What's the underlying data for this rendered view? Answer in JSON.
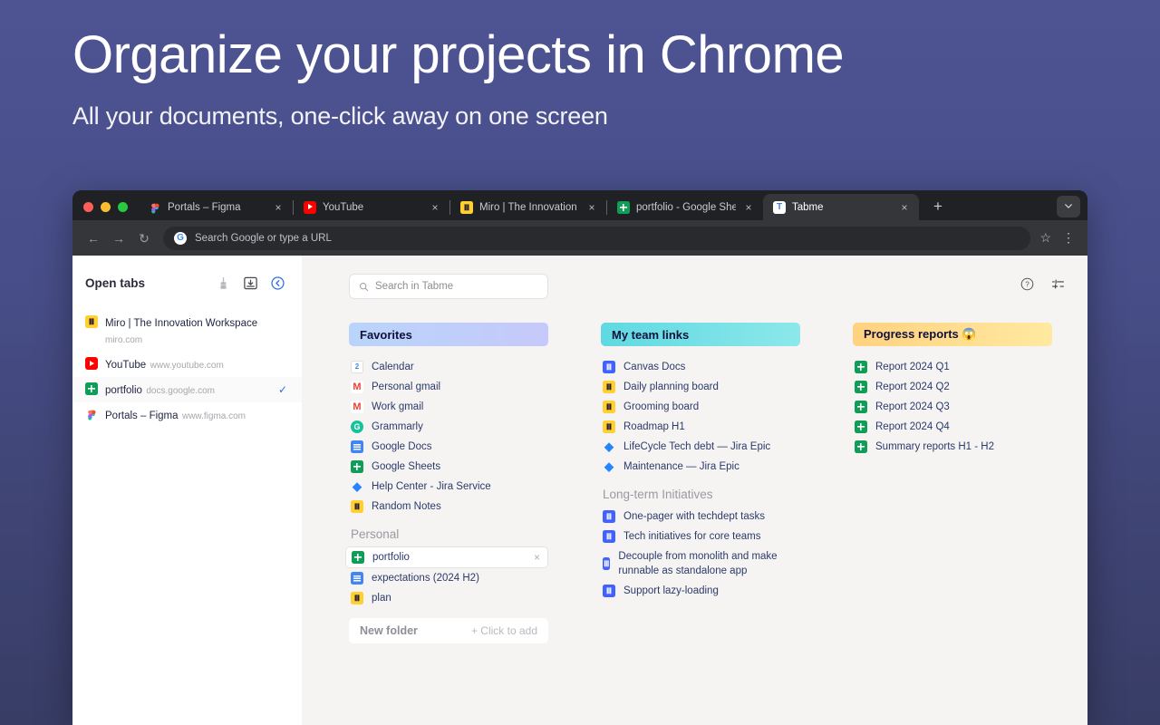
{
  "promo": {
    "title": "Organize your projects in Chrome",
    "subtitle": "All your documents, one-click away on one screen"
  },
  "browser": {
    "tabs": [
      {
        "title": "Portals – Figma",
        "favicon": "figma-icon",
        "close_label": "×",
        "active": false
      },
      {
        "title": "YouTube",
        "favicon": "youtube-icon",
        "close_label": "×",
        "active": false
      },
      {
        "title": "Miro | The Innovation Worksp",
        "favicon": "miro-icon",
        "close_label": "×",
        "active": false
      },
      {
        "title": "portfolio - Google Sheets",
        "favicon": "google-sheets-icon",
        "close_label": "×",
        "active": false
      },
      {
        "title": "Tabme",
        "favicon": "tabme-icon",
        "close_label": "×",
        "active": true
      }
    ],
    "new_tab_label": "+",
    "tab_list_chevron": "⌄",
    "nav": {
      "back": "←",
      "forward": "→",
      "reload": "↻"
    },
    "omnibox": {
      "placeholder": "Search Google or type a URL",
      "value": "",
      "engine_badge": "G"
    },
    "omnibox_actions": {
      "bookmark": "☆",
      "menu": "⋮"
    }
  },
  "sidebar": {
    "title": "Open tabs",
    "actions": [
      {
        "name": "clean-icon",
        "label": ""
      },
      {
        "name": "save-session-icon",
        "label": ""
      },
      {
        "name": "collapse-icon",
        "label": ""
      }
    ],
    "open_tabs": [
      {
        "title": "Miro | The Innovation Workspace",
        "url": "miro.com",
        "favicon": "miro-icon",
        "checked": false
      },
      {
        "title": "YouTube",
        "url": "www.youtube.com",
        "favicon": "youtube-icon",
        "checked": false
      },
      {
        "title": "portfolio",
        "url": "docs.google.com",
        "favicon": "google-sheets-icon",
        "checked": true,
        "check_glyph": "✓"
      },
      {
        "title": "Portals – Figma",
        "url": "www.figma.com",
        "favicon": "figma-icon",
        "checked": false
      }
    ]
  },
  "toolbar": {
    "search_placeholder": "Search in Tabme",
    "search_value": "",
    "search_icon": "🔍",
    "help_icon": "?",
    "settings_icon": "sliders"
  },
  "columns": [
    {
      "title": "Favorites",
      "accent": "#b9d4fb",
      "items": [
        {
          "label": "Calendar",
          "favicon": "google-calendar-icon",
          "type": "link"
        },
        {
          "label": "Personal gmail",
          "favicon": "gmail-icon",
          "type": "link"
        },
        {
          "label": "Work gmail",
          "favicon": "gmail-icon",
          "type": "link"
        },
        {
          "label": "Grammarly",
          "favicon": "grammarly-icon",
          "type": "link"
        },
        {
          "label": "Google Docs",
          "favicon": "google-docs-icon",
          "type": "link"
        },
        {
          "label": "Google Sheets",
          "favicon": "google-sheets-icon",
          "type": "link"
        },
        {
          "label": "Help Center - Jira Service",
          "favicon": "jira-icon",
          "type": "link"
        },
        {
          "label": "Random Notes",
          "favicon": "miro-icon",
          "type": "link"
        },
        {
          "label": "Personal",
          "type": "subheader"
        },
        {
          "label": "portfolio",
          "favicon": "google-sheets-icon",
          "type": "link",
          "boxed": true,
          "close_label": "×"
        },
        {
          "label": "expectations (2024 H2)",
          "favicon": "google-docs-icon",
          "type": "link"
        },
        {
          "label": "plan",
          "favicon": "miro-icon",
          "type": "link"
        }
      ]
    },
    {
      "title": "My team links",
      "accent": "#5fd9e2",
      "items": [
        {
          "label": "Canvas Docs",
          "favicon": "miro-blue-icon",
          "type": "link"
        },
        {
          "label": "Daily planning board",
          "favicon": "miro-icon",
          "type": "link"
        },
        {
          "label": "Grooming board",
          "favicon": "miro-icon",
          "type": "link"
        },
        {
          "label": "Roadmap H1",
          "favicon": "miro-icon",
          "type": "link"
        },
        {
          "label": "LifeCycle Tech debt — Jira Epic",
          "favicon": "jira-icon",
          "type": "link"
        },
        {
          "label": "Maintenance — Jira Epic",
          "favicon": "jira-icon",
          "type": "link"
        },
        {
          "label": "Long-term Initiatives",
          "type": "subheader"
        },
        {
          "label": "One-pager with techdept tasks",
          "favicon": "miro-blue-icon",
          "type": "link"
        },
        {
          "label": "Tech initiatives for core teams",
          "favicon": "miro-blue-icon",
          "type": "link"
        },
        {
          "label": "Decouple from monolith and make runnable as standalone app",
          "favicon": "miro-blue-icon",
          "type": "link"
        },
        {
          "label": "Support lazy-loading",
          "favicon": "miro-blue-icon",
          "type": "link"
        }
      ]
    },
    {
      "title": "Progress reports 😱",
      "accent": "#ffd27f",
      "items": [
        {
          "label": "Report 2024 Q1",
          "favicon": "google-sheets-icon",
          "type": "link"
        },
        {
          "label": "Report 2024 Q2",
          "favicon": "google-sheets-icon",
          "type": "link"
        },
        {
          "label": "Report 2024 Q3",
          "favicon": "google-sheets-icon",
          "type": "link"
        },
        {
          "label": "Report 2024 Q4",
          "favicon": "google-sheets-icon",
          "type": "link"
        },
        {
          "label": "Summary reports H1 - H2",
          "favicon": "google-sheets-icon",
          "type": "link"
        }
      ]
    }
  ],
  "new_folder": {
    "label": "New folder",
    "action": "+ Click to add"
  }
}
